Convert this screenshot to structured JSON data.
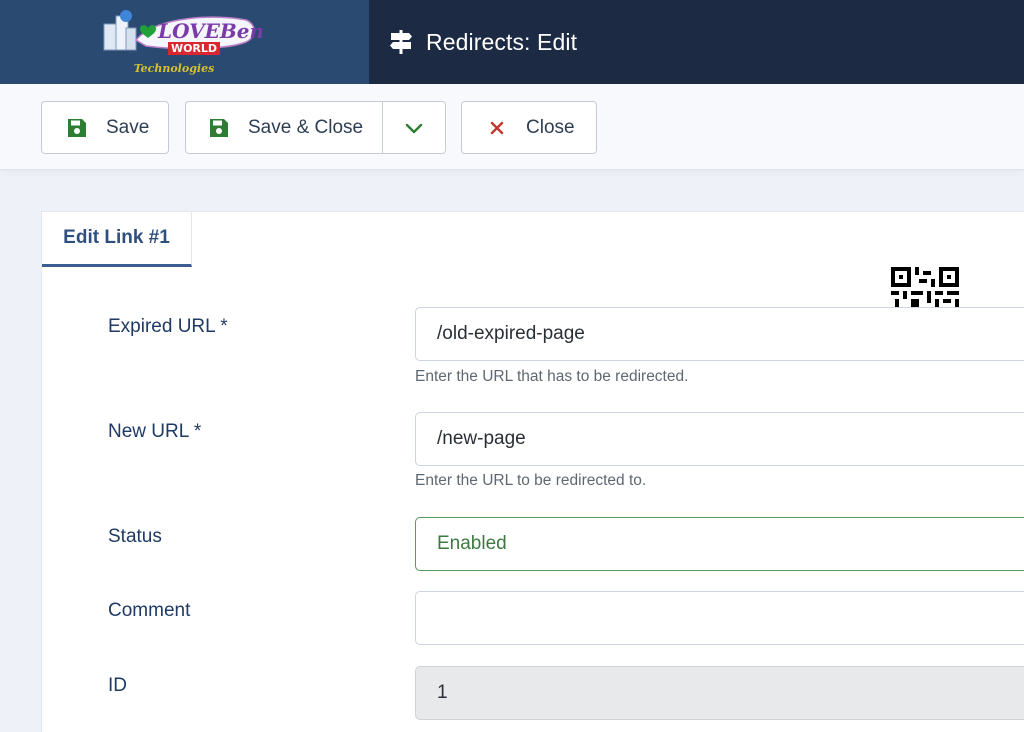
{
  "header": {
    "title": "Redirects: Edit",
    "icon": "signpost-icon",
    "logo": {
      "name": "loveb-world-logo",
      "text_line1": "LOVEBeng",
      "text_line2": "WORLD",
      "text_line3": "Technologies"
    }
  },
  "toolbar": {
    "save_label": "Save",
    "save_close_label": "Save & Close",
    "close_label": "Close",
    "icons": {
      "save": "floppy-disk-icon",
      "dropdown": "chevron-down-icon",
      "close": "x-icon"
    },
    "colors": {
      "save_icon": "#2e7d32",
      "close_icon": "#c0392b"
    }
  },
  "tabs": [
    {
      "label": "Edit Link #1",
      "active": true
    }
  ],
  "form": {
    "expired_url": {
      "label": "Expired URL *",
      "value": "/old-expired-page",
      "help": "Enter the URL that has to be redirected."
    },
    "new_url": {
      "label": "New URL *",
      "value": "/new-page",
      "help": "Enter the URL to be redirected to."
    },
    "status": {
      "label": "Status",
      "value": "Enabled"
    },
    "comment": {
      "label": "Comment",
      "value": ""
    },
    "id": {
      "label": "ID",
      "value": "1"
    }
  },
  "colors": {
    "header_bg": "#1c2b43",
    "logo_bg": "#2b4a72",
    "accent": "#3c5d93",
    "enabled_green": "#3d7a42"
  }
}
